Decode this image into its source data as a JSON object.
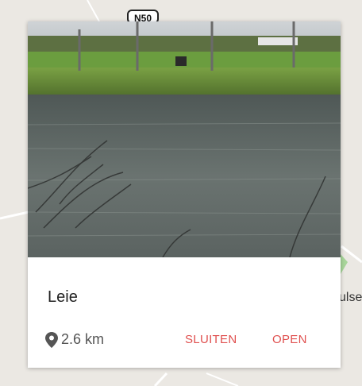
{
  "map": {
    "road_badge": "N50",
    "side_label": "ulse"
  },
  "card": {
    "title": "Leie",
    "distance": "2.6 km",
    "close_label": "SLUITEN",
    "open_label": "OPEN",
    "icons": {
      "distance": "location-pin-icon"
    }
  },
  "colors": {
    "accent": "#e0504f",
    "map_background": "#ebe8e3"
  }
}
